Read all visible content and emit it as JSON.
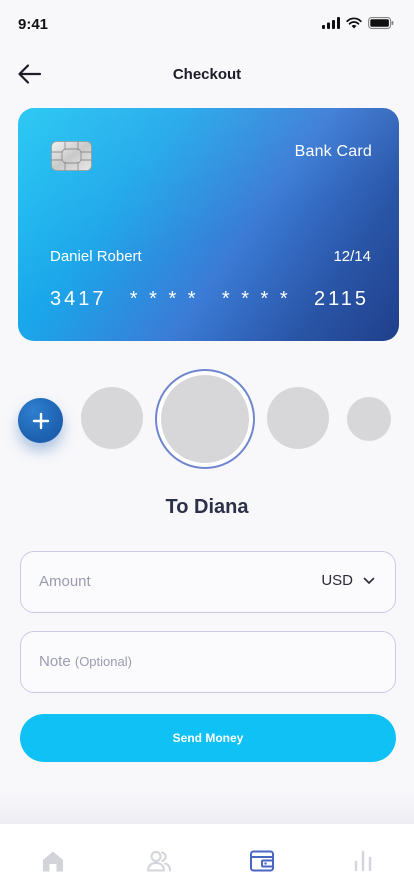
{
  "status_bar": {
    "time": "9:41"
  },
  "header": {
    "title": "Checkout"
  },
  "card": {
    "type_label": "Bank Card",
    "holder_name": "Daniel Robert",
    "expiry": "12/14",
    "number_groups": [
      "3417",
      "* * * *",
      "* * * *",
      "2115"
    ]
  },
  "recipient": {
    "label": "To Diana"
  },
  "form": {
    "amount_placeholder": "Amount",
    "currency": "USD",
    "note_placeholder": "Note",
    "note_optional": "(Optional)"
  },
  "actions": {
    "send_label": "Send Money"
  },
  "colors": {
    "accent": "#0fc1f4",
    "add_button": "#1c5fae",
    "active_tab": "#4a66c4",
    "inactive_tab": "#d3d4da"
  },
  "tab_bar": {
    "tabs": [
      "home-icon",
      "contacts-icon",
      "wallet-icon",
      "stats-icon"
    ],
    "active": "wallet-icon"
  }
}
